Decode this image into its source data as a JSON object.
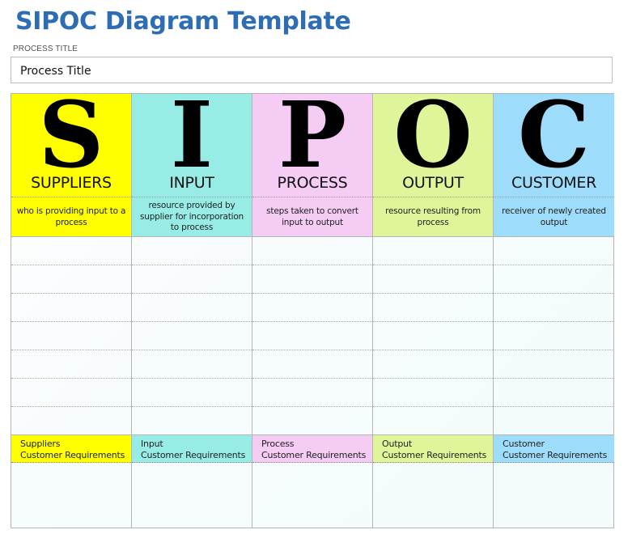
{
  "page": {
    "title": "SIPOC Diagram Template",
    "process_title_label": "PROCESS TITLE",
    "process_title_value": "Process Title"
  },
  "columns": [
    {
      "key": "suppliers",
      "letter": "S",
      "heading": "SUPPLIERS",
      "description": "who is providing input to a process",
      "req_line1": "Suppliers",
      "req_line2": "Customer Requirements",
      "color": "#ffff00"
    },
    {
      "key": "input",
      "letter": "I",
      "heading": "INPUT",
      "description": "resource provided by supplier for incorporation to process",
      "req_line1": "Input",
      "req_line2": "Customer Requirements",
      "color": "#97ede6"
    },
    {
      "key": "process",
      "letter": "P",
      "heading": "PROCESS",
      "description": "steps taken to convert input to output",
      "req_line1": "Process",
      "req_line2": "Customer Requirements",
      "color": "#f4ccf4"
    },
    {
      "key": "output",
      "letter": "O",
      "heading": "OUTPUT",
      "description": "resource resulting from process",
      "req_line1": "Output",
      "req_line2": "Customer Requirements",
      "color": "#e0f59a"
    },
    {
      "key": "customer",
      "letter": "C",
      "heading": "CUSTOMER",
      "description": "receiver of newly created output",
      "req_line1": "Customer",
      "req_line2": "Customer Requirements",
      "color": "#9ddcfb"
    }
  ],
  "table": {
    "entry_rows": 7
  }
}
